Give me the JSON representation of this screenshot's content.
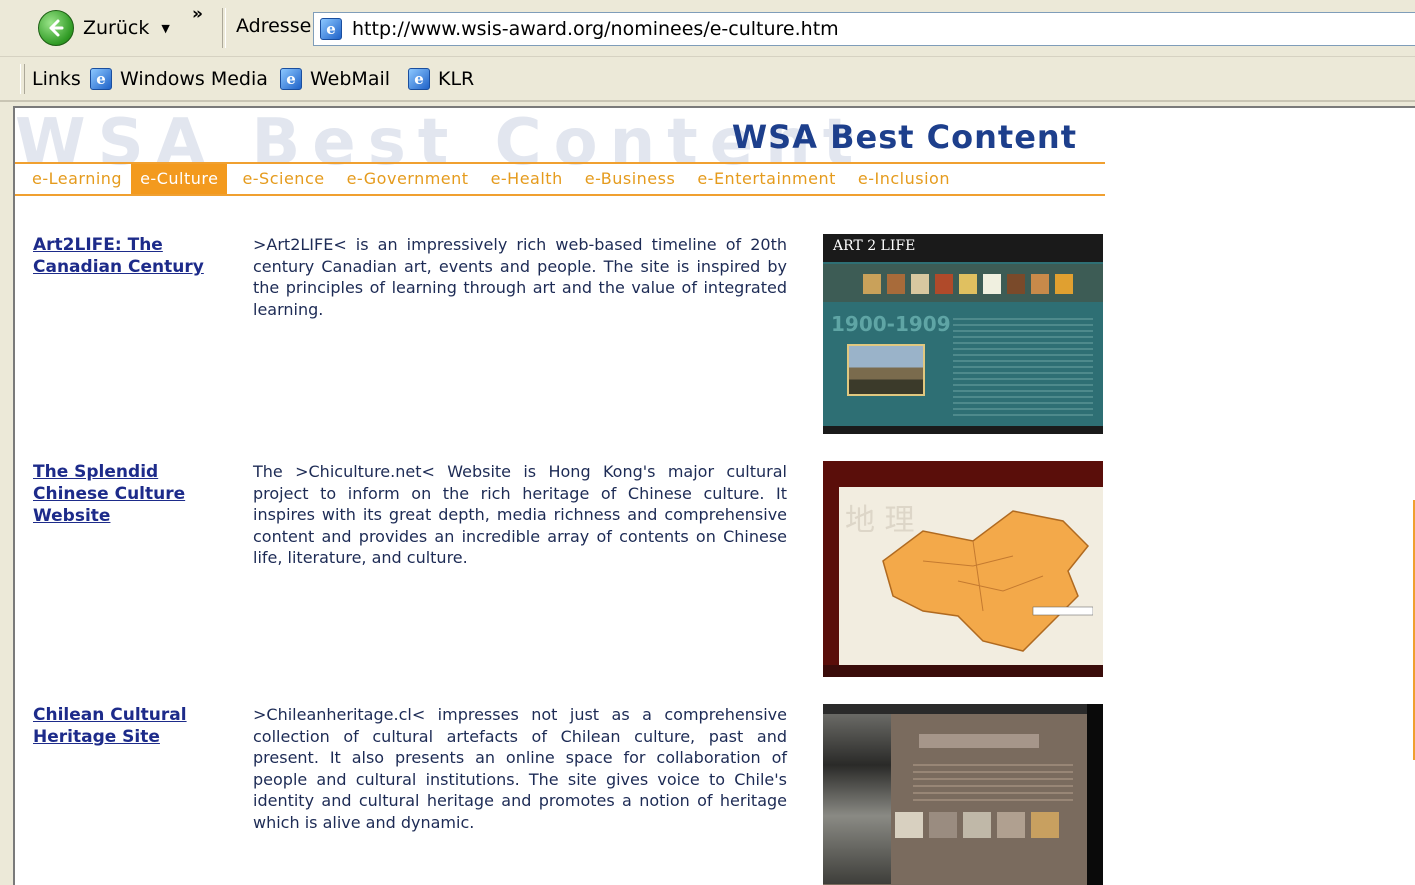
{
  "browser": {
    "back_label": "Zurück",
    "more_chevron": "»",
    "address_label": "Adresse",
    "url": "http://www.wsis-award.org/nominees/e-culture.htm",
    "links_label": "Links",
    "links": [
      "Windows Media",
      "WebMail",
      "KLR"
    ]
  },
  "page": {
    "watermark": "WSA Best Content",
    "banner_title": "WSA Best Content",
    "nav": [
      {
        "label": "e-Learning",
        "active": false
      },
      {
        "label": "e-Culture",
        "active": true
      },
      {
        "label": "e-Science",
        "active": false
      },
      {
        "label": "e-Government",
        "active": false
      },
      {
        "label": "e-Health",
        "active": false
      },
      {
        "label": "e-Business",
        "active": false
      },
      {
        "label": "e-Entertainment",
        "active": false
      },
      {
        "label": "e-Inclusion",
        "active": false
      }
    ],
    "entries": [
      {
        "title": "Art2LIFE: The Canadian Century",
        "description": ">Art2LIFE< is an impressively rich web-based timeline of 20th century Canadian art, events and people. The site is inspired by the principles of learning through art and the value of integrated learning.",
        "thumb_logo": "ART 2 LIFE",
        "thumb_year": "1900-1909"
      },
      {
        "title": "The Splendid Chinese Culture Website",
        "description": "The >Chiculture.net< Website is Hong Kong's major cultural project to inform on the rich heritage of Chinese culture. It inspires with its great depth, media richness and comprehensive content and provides an incredible array of contents on Chinese life, literature, and culture.",
        "thumb_watermark": "地 理"
      },
      {
        "title": "Chilean Cultural Heritage Site",
        "description": ">Chileanheritage.cl< impresses not just as a comprehensive collection of cultural artefacts of Chilean culture, past and present. It also presents an online space for collaboration of people and cultural institutions. The site gives voice to Chile's identity and cultural heritage and promotes a notion of heritage which is alive and dynamic."
      }
    ]
  },
  "colors": {
    "accent_orange": "#f39a1e",
    "title_blue": "#1d3f8c",
    "link_blue": "#1d2b8a"
  }
}
